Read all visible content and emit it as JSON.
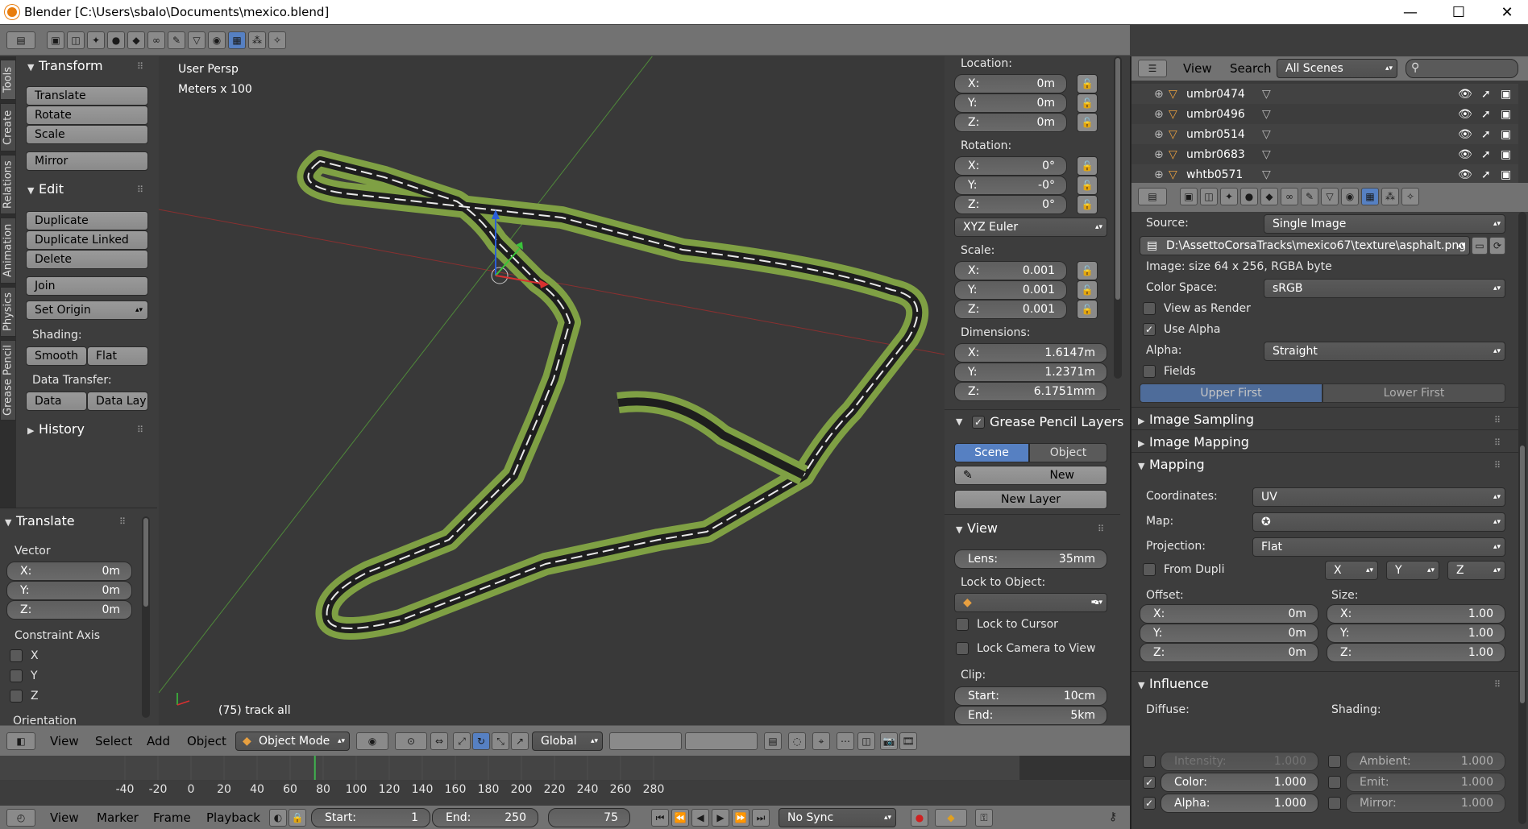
{
  "window": {
    "title": "Blender [C:\\Users\\sbalo\\Documents\\mexico.blend]",
    "minimize": "—",
    "maximize": "☐",
    "close": "✕"
  },
  "tool_tabs": [
    "Tools",
    "Create",
    "Relations",
    "Animation",
    "Physics",
    "Grease Pencil"
  ],
  "toolshelf": {
    "transform_header": "Transform",
    "translate": "Translate",
    "rotate": "Rotate",
    "scale": "Scale",
    "mirror": "Mirror",
    "edit_header": "Edit",
    "duplicate": "Duplicate",
    "duplicate_linked": "Duplicate Linked",
    "delete": "Delete",
    "join": "Join",
    "set_origin": "Set Origin",
    "shading_label": "Shading:",
    "smooth": "Smooth",
    "flat": "Flat",
    "data_transfer_label": "Data Transfer:",
    "data": "Data",
    "data_lay": "Data Lay",
    "history_header": "History"
  },
  "operator": {
    "header": "Translate",
    "vector_label": "Vector",
    "x_label": "X:",
    "x": "0m",
    "y_label": "Y:",
    "y": "0m",
    "z_label": "Z:",
    "z": "0m",
    "constraint_label": "Constraint Axis",
    "cx": "X",
    "cy": "Y",
    "cz": "Z",
    "orientation_label": "Orientation"
  },
  "viewport": {
    "persp": "User Persp",
    "units": "Meters x 100",
    "object_label": "(75) track all"
  },
  "properties_n": {
    "location_label": "Location:",
    "loc_x": "0m",
    "loc_y": "0m",
    "loc_z": "0m",
    "rotation_label": "Rotation:",
    "rot_x": "0°",
    "rot_y": "-0°",
    "rot_z": "0°",
    "rot_mode": "XYZ Euler",
    "scale_label": "Scale:",
    "sc_x": "0.001",
    "sc_y": "0.001",
    "sc_z": "0.001",
    "dims_label": "Dimensions:",
    "dim_x": "1.6147m",
    "dim_y": "1.2371m",
    "dim_z": "6.1751mm",
    "x": "X:",
    "y": "Y:",
    "z": "Z:",
    "gp_header": "Grease Pencil Layers",
    "gp_scene": "Scene",
    "gp_object": "Object",
    "gp_new": "New",
    "gp_new_layer": "New Layer",
    "view_header": "View",
    "lens_label": "Lens:",
    "lens": "35mm",
    "lock_obj_label": "Lock to Object:",
    "lock_cursor": "Lock to Cursor",
    "lock_camera": "Lock Camera to View",
    "clip_label": "Clip:",
    "start_label": "Start:",
    "clip_start": "10cm",
    "end_label": "End:",
    "clip_end": "5km"
  },
  "outliner": {
    "view": "View",
    "search": "Search",
    "scenes": "All Scenes",
    "rows": [
      "umbr0474",
      "umbr0496",
      "umbr0514",
      "umbr0683",
      "whtb0571"
    ]
  },
  "texture": {
    "source_label": "Source:",
    "source": "Single Image",
    "path": "D:\\AssettoCorsaTracks\\mexico67\\texture\\asphalt.png",
    "info": "Image: size 64 x 256, RGBA byte",
    "colorspace_label": "Color Space:",
    "colorspace": "sRGB",
    "view_as_render": "View as Render",
    "use_alpha": "Use Alpha",
    "alpha_label": "Alpha:",
    "alpha": "Straight",
    "fields": "Fields",
    "upper_first": "Upper First",
    "lower_first": "Lower First",
    "image_sampling": "Image Sampling",
    "image_mapping": "Image Mapping",
    "mapping": "Mapping",
    "coords_label": "Coordinates:",
    "coords": "UV",
    "map_label": "Map:",
    "projection_label": "Projection:",
    "projection": "Flat",
    "from_dupli": "From Dupli",
    "px": "X",
    "py": "Y",
    "pz": "Z",
    "offset_label": "Offset:",
    "size_label": "Size:",
    "off_x": "0m",
    "off_y": "0m",
    "off_z": "0m",
    "size_x": "1.00",
    "size_y": "1.00",
    "size_z": "1.00",
    "influence": "Influence",
    "diffuse_label": "Diffuse:",
    "shading_label": "Shading:",
    "intensity_label": "Intensity:",
    "intensity": "1.000",
    "color_label": "Color:",
    "color": "1.000",
    "alpha_inf_label": "Alpha:",
    "alpha_inf": "1.000",
    "ambient_label": "Ambient:",
    "ambient": "1.000",
    "emit_label": "Emit:",
    "emit": "1.000",
    "mirror_label": "Mirror:",
    "mirror": "1.000"
  },
  "view3d_header": {
    "view": "View",
    "select": "Select",
    "add": "Add",
    "object": "Object",
    "mode": "Object Mode",
    "orientation": "Global"
  },
  "timeline": {
    "ticks": [
      "-40",
      "-20",
      "0",
      "20",
      "40",
      "60",
      "80",
      "100",
      "120",
      "140",
      "160",
      "180",
      "200",
      "220",
      "240",
      "260",
      "280"
    ],
    "current_frame": 75
  },
  "timeline_header": {
    "view": "View",
    "marker": "Marker",
    "frame": "Frame",
    "playback": "Playback",
    "start_label": "Start:",
    "start": "1",
    "end_label": "End:",
    "end": "250",
    "current": "75",
    "sync": "No Sync"
  },
  "colors": {
    "accent": "#5680c2",
    "frame_line": "#3fb24f",
    "track_grass": "#7fa044",
    "track_asphalt": "#2b2b2b"
  }
}
